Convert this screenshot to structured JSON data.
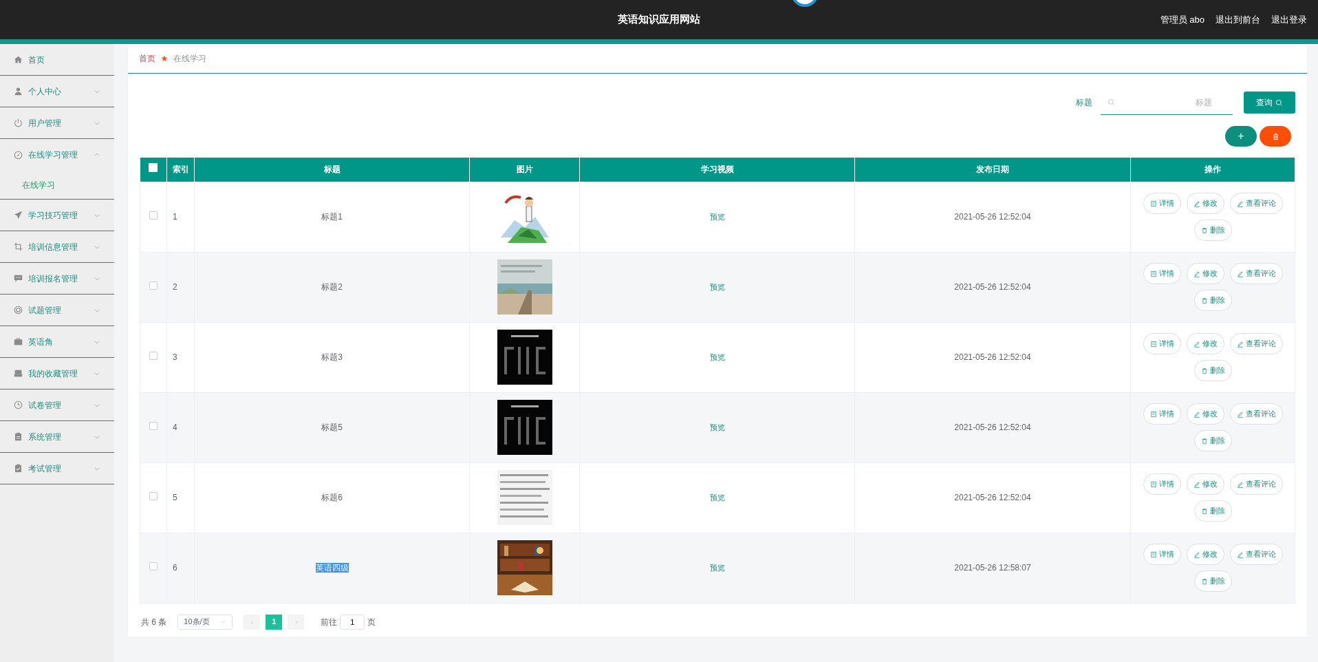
{
  "header": {
    "title": "英语知识应用网站",
    "links": [
      "管理员 abo",
      "退出到前台",
      "退出登录"
    ]
  },
  "sidebar": {
    "items": [
      {
        "label": "首页",
        "kind": "link"
      },
      {
        "label": "个人中心",
        "kind": "menu",
        "expanded": false
      },
      {
        "label": "用户管理",
        "kind": "menu",
        "expanded": false
      },
      {
        "label": "在线学习管理",
        "kind": "menu",
        "expanded": true,
        "children": [
          {
            "label": "在线学习"
          }
        ]
      },
      {
        "label": "学习技巧管理",
        "kind": "menu",
        "expanded": false
      },
      {
        "label": "培训信息管理",
        "kind": "menu",
        "expanded": false
      },
      {
        "label": "培训报名管理",
        "kind": "menu",
        "expanded": false
      },
      {
        "label": "试题管理",
        "kind": "menu",
        "expanded": false
      },
      {
        "label": "英语角",
        "kind": "menu",
        "expanded": false
      },
      {
        "label": "我的收藏管理",
        "kind": "menu",
        "expanded": false
      },
      {
        "label": "试卷管理",
        "kind": "menu",
        "expanded": false
      },
      {
        "label": "系统管理",
        "kind": "menu",
        "expanded": false
      },
      {
        "label": "考试管理",
        "kind": "menu",
        "expanded": false
      }
    ]
  },
  "breadcrumb": [
    "首页",
    "在线学习"
  ],
  "search": {
    "label": "标题",
    "placeholder": "标题",
    "button": "查询"
  },
  "toolbar": {
    "add": "+"
  },
  "table": {
    "select_all": false,
    "columns": [
      "索引",
      "标题",
      "图片",
      "学习视频",
      "发布日期",
      "操作"
    ],
    "rows": [
      {
        "checked": false,
        "index": "1",
        "title": "标题1",
        "highlighted": false,
        "video": "预览",
        "date": "2021-05-26 12:52:04",
        "actions": [
          {
            "kind": "detail",
            "label": "详情"
          },
          {
            "kind": "edit",
            "label": "修改"
          },
          {
            "kind": "edit",
            "label": "查看评论"
          },
          {
            "kind": "delete",
            "label": "删除"
          }
        ]
      },
      {
        "checked": false,
        "index": "2",
        "title": "标题2",
        "highlighted": false,
        "video": "预览",
        "date": "2021-05-26 12:52:04",
        "actions": [
          {
            "kind": "detail",
            "label": "详情"
          },
          {
            "kind": "edit",
            "label": "修改"
          },
          {
            "kind": "edit",
            "label": "查看评论"
          },
          {
            "kind": "delete",
            "label": "删除"
          }
        ]
      },
      {
        "checked": false,
        "index": "3",
        "title": "标题3",
        "highlighted": false,
        "video": "预览",
        "date": "2021-05-26 12:52:04",
        "actions": [
          {
            "kind": "detail",
            "label": "详情"
          },
          {
            "kind": "edit",
            "label": "修改"
          },
          {
            "kind": "edit",
            "label": "查看评论"
          },
          {
            "kind": "delete",
            "label": "删除"
          }
        ]
      },
      {
        "checked": false,
        "index": "4",
        "title": "标题5",
        "highlighted": false,
        "video": "预览",
        "date": "2021-05-26 12:52:04",
        "actions": [
          {
            "kind": "detail",
            "label": "详情"
          },
          {
            "kind": "edit",
            "label": "修改"
          },
          {
            "kind": "edit",
            "label": "查看评论"
          },
          {
            "kind": "delete",
            "label": "删除"
          }
        ]
      },
      {
        "checked": false,
        "index": "5",
        "title": "标题6",
        "highlighted": false,
        "video": "预览",
        "date": "2021-05-26 12:52:04",
        "actions": [
          {
            "kind": "detail",
            "label": "详情"
          },
          {
            "kind": "edit",
            "label": "修改"
          },
          {
            "kind": "edit",
            "label": "查看评论"
          },
          {
            "kind": "delete",
            "label": "删除"
          }
        ]
      },
      {
        "checked": false,
        "index": "6",
        "title": "英语四级",
        "highlighted": true,
        "video": "预览",
        "date": "2021-05-26 12:58:07",
        "actions": [
          {
            "kind": "detail",
            "label": "详情"
          },
          {
            "kind": "edit",
            "label": "修改"
          },
          {
            "kind": "edit",
            "label": "查看评论"
          },
          {
            "kind": "delete",
            "label": "删除"
          }
        ]
      }
    ]
  },
  "pagination": {
    "total": "共 6 条",
    "page_size": "10条/页",
    "pages": [
      {
        "label": "1",
        "selected": true
      }
    ],
    "goto_label": "前往",
    "goto_value": "1",
    "goto_suffix": "页"
  }
}
